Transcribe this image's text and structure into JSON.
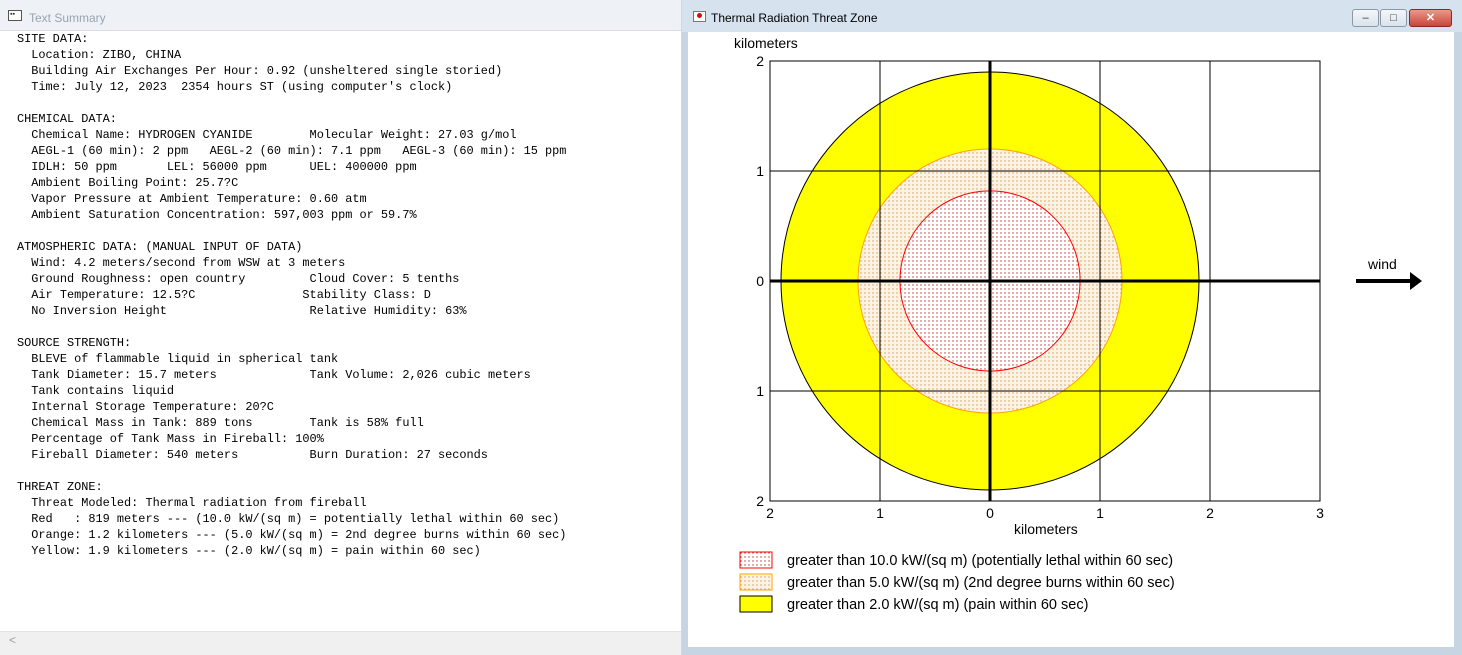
{
  "text_window": {
    "title": "Text Summary",
    "lines": [
      "SITE DATA:",
      "  Location: ZIBO, CHINA",
      "  Building Air Exchanges Per Hour: 0.92 (unsheltered single storied)",
      "  Time: July 12, 2023  2354 hours ST (using computer's clock)",
      "",
      "CHEMICAL DATA:",
      "  Chemical Name: HYDROGEN CYANIDE        Molecular Weight: 27.03 g/mol",
      "  AEGL-1 (60 min): 2 ppm   AEGL-2 (60 min): 7.1 ppm   AEGL-3 (60 min): 15 ppm",
      "  IDLH: 50 ppm       LEL: 56000 ppm      UEL: 400000 ppm",
      "  Ambient Boiling Point: 25.7?C",
      "  Vapor Pressure at Ambient Temperature: 0.60 atm",
      "  Ambient Saturation Concentration: 597,003 ppm or 59.7%",
      "",
      "ATMOSPHERIC DATA: (MANUAL INPUT OF DATA)",
      "  Wind: 4.2 meters/second from WSW at 3 meters",
      "  Ground Roughness: open country         Cloud Cover: 5 tenths",
      "  Air Temperature: 12.5?C               Stability Class: D",
      "  No Inversion Height                    Relative Humidity: 63%",
      "",
      "SOURCE STRENGTH:",
      "  BLEVE of flammable liquid in spherical tank",
      "  Tank Diameter: 15.7 meters             Tank Volume: 2,026 cubic meters",
      "  Tank contains liquid",
      "  Internal Storage Temperature: 20?C",
      "  Chemical Mass in Tank: 889 tons        Tank is 58% full",
      "  Percentage of Tank Mass in Fireball: 100%",
      "  Fireball Diameter: 540 meters          Burn Duration: 27 seconds",
      "",
      "THREAT ZONE:",
      "  Threat Modeled: Thermal radiation from fireball",
      "  Red   : 819 meters --- (10.0 kW/(sq m) = potentially lethal within 60 sec)",
      "  Orange: 1.2 kilometers --- (5.0 kW/(sq m) = 2nd degree burns within 60 sec)",
      "  Yellow: 1.9 kilometers --- (2.0 kW/(sq m) = pain within 60 sec)"
    ],
    "scroll_left_glyph": "<"
  },
  "threat_window": {
    "title": "Thermal Radiation Threat Zone",
    "controls": {
      "minimize": "–",
      "maximize": "□",
      "close": "✕"
    },
    "wind_label": "wind"
  },
  "chart_data": {
    "type": "threat-zone",
    "xlabel": "kilometers",
    "ylabel": "kilometers",
    "x_ticks": [
      "2",
      "1",
      "0",
      "1",
      "2",
      "3"
    ],
    "x_tick_values": [
      -2,
      -1,
      0,
      1,
      2,
      3
    ],
    "y_ticks": [
      "2",
      "1",
      "0",
      "1",
      "2"
    ],
    "y_tick_values": [
      2,
      1,
      0,
      -1,
      -2
    ],
    "xlim": [
      -2,
      3
    ],
    "ylim": [
      -2,
      2
    ],
    "grid": true,
    "zones": [
      {
        "name": "Red",
        "radius_km": 0.819,
        "color": "#ff0000",
        "fill": "#f6eaea",
        "label": "greater than 10.0 kW/(sq m) (potentially lethal within 60 sec)"
      },
      {
        "name": "Orange",
        "radius_km": 1.2,
        "color": "#ffa500",
        "fill": "#f5e8d2",
        "label": "greater than 5.0 kW/(sq m) (2nd degree burns within 60 sec)"
      },
      {
        "name": "Yellow",
        "radius_km": 1.9,
        "color": "#ffff00",
        "fill": "#ffff00",
        "label": "greater than 2.0 kW/(sq m) (pain within 60 sec)"
      }
    ],
    "legend_position": "bottom-left"
  }
}
